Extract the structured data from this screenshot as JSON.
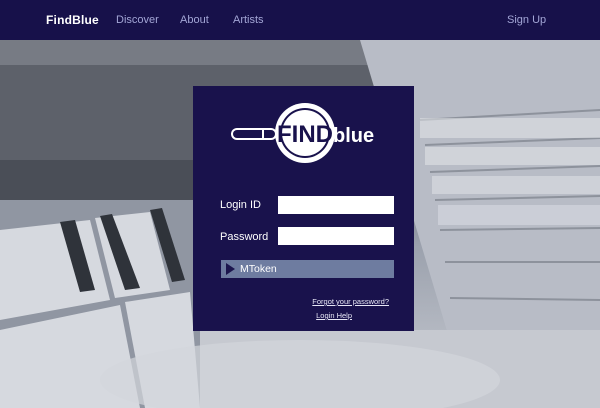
{
  "nav": {
    "brand": "FindBlue",
    "links": [
      "Discover",
      "About",
      "Artists"
    ],
    "signup": "Sign Up"
  },
  "logo": {
    "find": "FIND",
    "blue": "blue"
  },
  "login": {
    "login_id_label": "Login ID",
    "password_label": "Password",
    "login_id_value": "",
    "password_value": "",
    "mtoken_label": "MToken",
    "forgot_password": "Forgot your password?",
    "login_help": "Login Help"
  },
  "colors": {
    "nav_background": "#17114a",
    "panel_background": "#19124c",
    "button_background": "#6e7ca0",
    "nav_link": "#a3a6d6"
  },
  "icons": {
    "button": "play-triangle-icon",
    "logo": "magnifier-logo-icon"
  }
}
